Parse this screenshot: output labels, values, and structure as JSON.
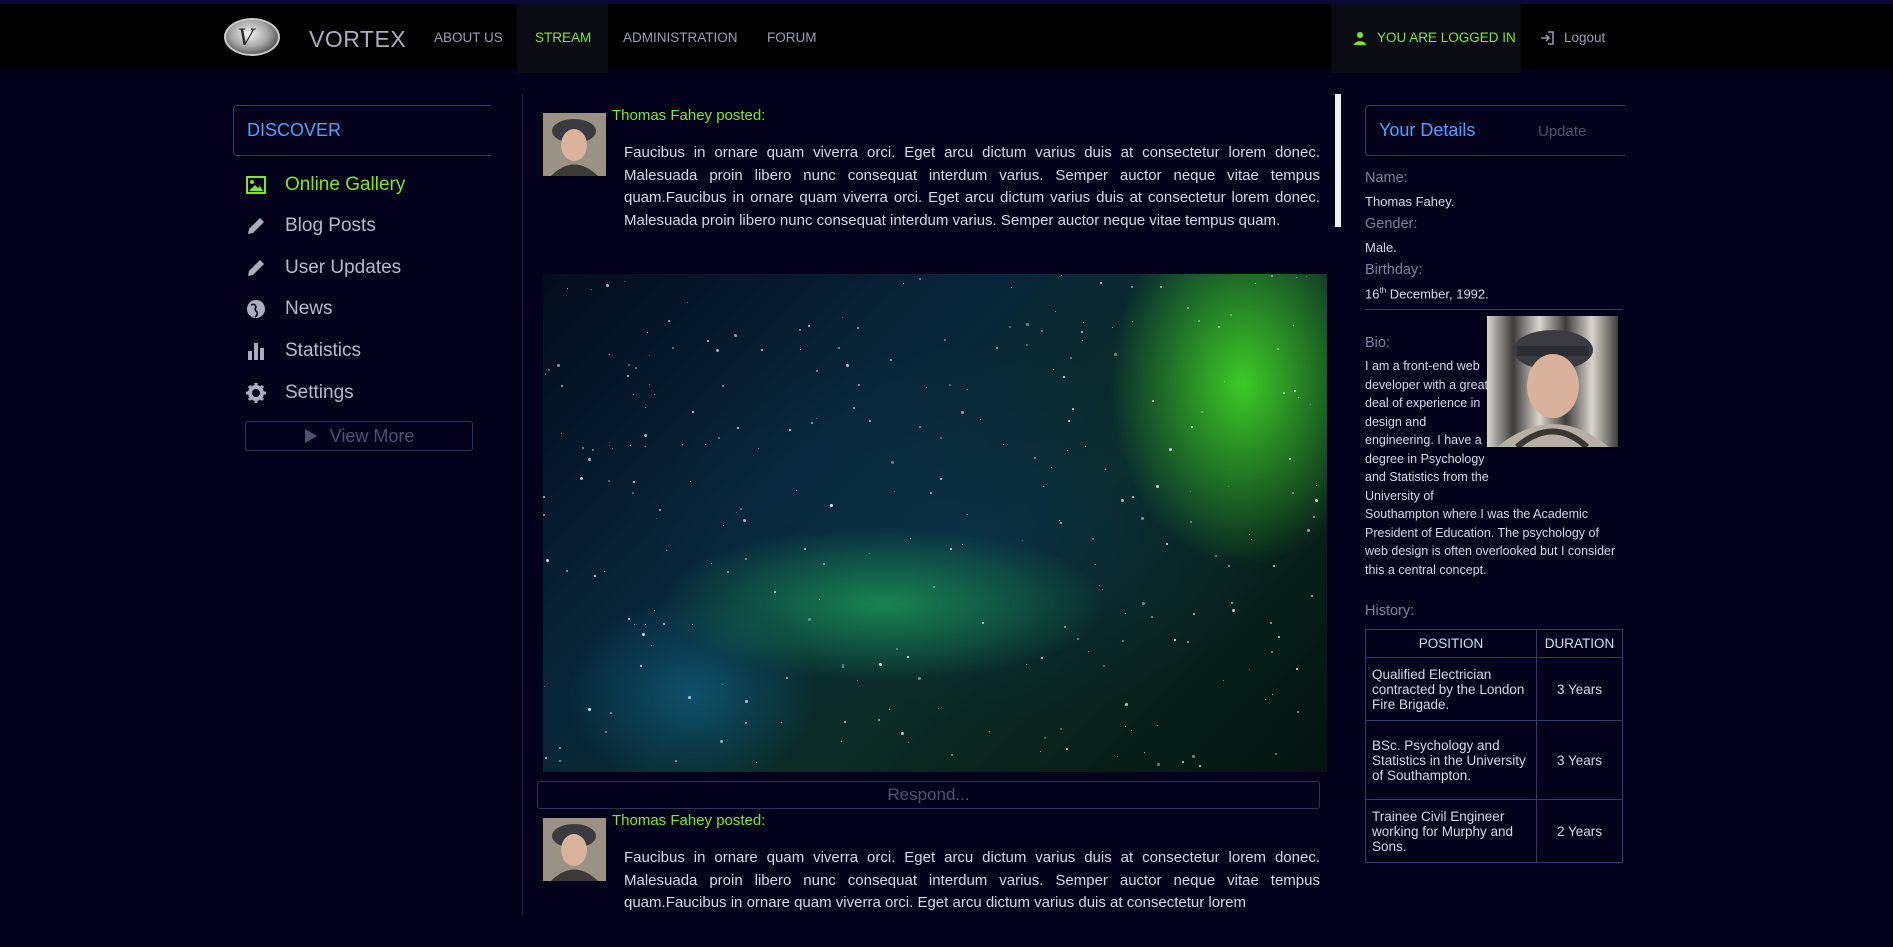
{
  "nav": {
    "brand": "VORTEX",
    "links": [
      {
        "label": "ABOUT US"
      },
      {
        "label": "STREAM"
      },
      {
        "label": "ADMINISTRATION"
      },
      {
        "label": "FORUM"
      }
    ],
    "active_link": "STREAM",
    "logged_in_label": "YOU ARE LOGGED IN",
    "logout_label": "Logout",
    "accent_color": "#7ee81f"
  },
  "sidebar": {
    "heading": "DISCOVER",
    "items": [
      {
        "label": "Online Gallery",
        "icon": "image-icon",
        "active": true
      },
      {
        "label": "Blog Posts",
        "icon": "pencil-icon"
      },
      {
        "label": "User Updates",
        "icon": "pencil-icon"
      },
      {
        "label": "News",
        "icon": "globe-icon"
      },
      {
        "label": "Statistics",
        "icon": "bar-chart-icon"
      },
      {
        "label": "Settings",
        "icon": "gear-icon"
      }
    ],
    "view_more_label": "View More"
  },
  "stream": {
    "posts": [
      {
        "author": "Thomas Fahey posted:",
        "body": "Faucibus in ornare quam viverra orci. Eget arcu dictum varius duis at consectetur lorem donec. Malesuada proin libero nunc consequat interdum varius. Semper auctor neque vitae tempus quam.Faucibus in ornare quam viverra orci. Eget arcu dictum varius duis at consectetur lorem donec. Malesuada proin libero nunc consequat interdum varius. Semper auctor neque vitae tempus quam."
      },
      {
        "author": "Thomas Fahey posted:",
        "body": "Faucibus in ornare quam viverra orci. Eget arcu dictum varius duis at consectetur lorem donec. Malesuada proin libero nunc consequat interdum varius. Semper auctor neque vitae tempus quam.Faucibus in ornare quam viverra orci. Eget arcu dictum varius duis at consectetur lorem"
      }
    ],
    "respond_placeholder": "Respond..."
  },
  "details": {
    "title": "Your Details",
    "update_label": "Update",
    "name_label": "Name:",
    "name_value": "Thomas Fahey.",
    "gender_label": "Gender:",
    "gender_value": "Male.",
    "birthday_label": "Birthday:",
    "birthday_day": "16",
    "birthday_suffix": "th",
    "birthday_rest": " December, 1992.",
    "bio_label": "Bio:",
    "bio_text": "I am a front-end web developer with a great deal of experience in design and engineering. I have a degree in Psychology and Statistics from the University of Southampton where I was the Academic President of Education. The psychology of web design is often overlooked but I consider this a central concept.",
    "history_label": "History:",
    "history_columns": [
      "POSITION",
      "DURATION"
    ],
    "history_rows": [
      {
        "position": "Qualified Electrician contracted by the London Fire Brigade.",
        "duration": "3 Years"
      },
      {
        "position": "BSc. Psychology and Statistics in the University of Southampton.",
        "duration": "3 Years"
      },
      {
        "position": "Trainee Civil Engineer working for Murphy and Sons.",
        "duration": "2 Years"
      }
    ]
  }
}
